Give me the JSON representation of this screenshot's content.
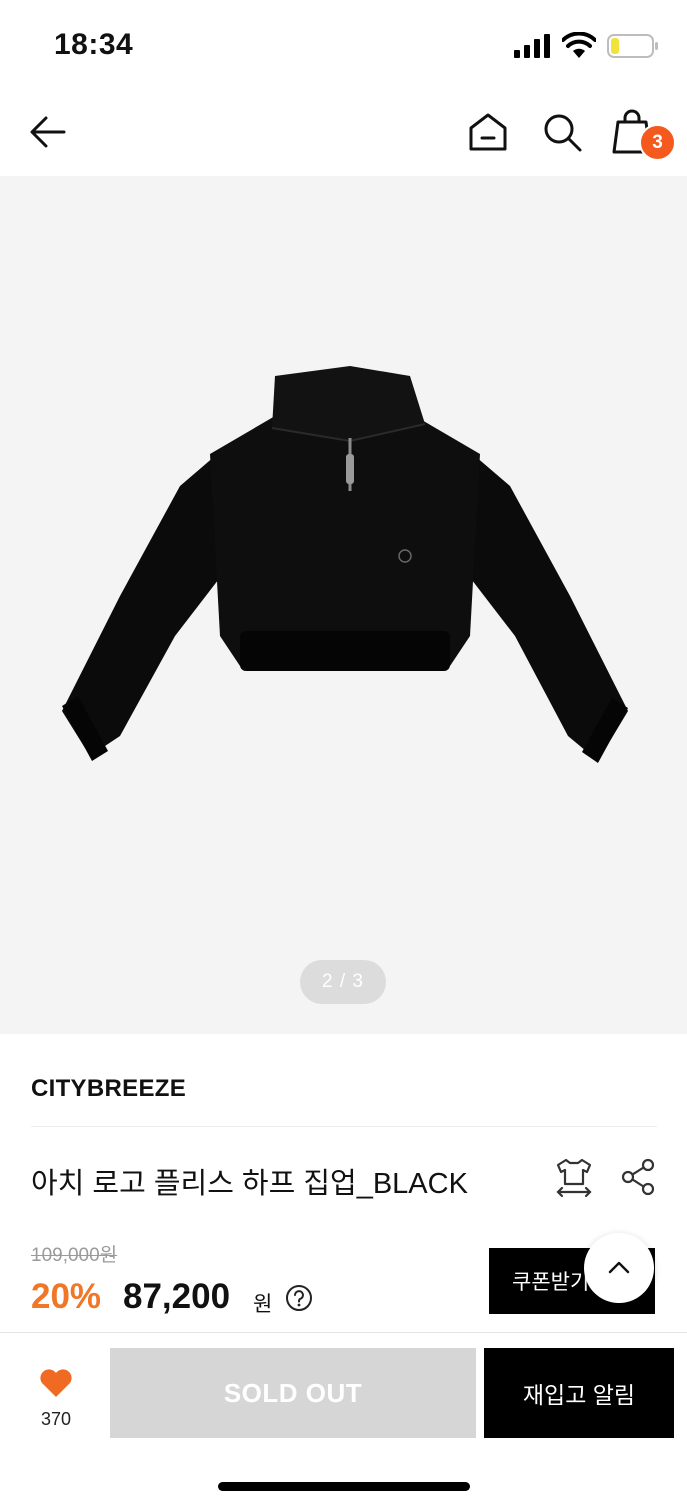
{
  "status_bar": {
    "time": "18:34"
  },
  "nav": {
    "cart_count": "3"
  },
  "gallery": {
    "pager": "2 / 3"
  },
  "product": {
    "brand": "CITYBREEZE",
    "title": "아치 로고 플리스 하프 집업_BLACK",
    "original_price": "109,000원",
    "discount": "20%",
    "price": "87,200",
    "currency": "원"
  },
  "actions": {
    "coupon_label": "쿠폰받기",
    "like_count": "370",
    "soldout_label": "SOLD OUT",
    "restock_label": "재입고 알림"
  },
  "colors": {
    "accent": "#f07628",
    "badge": "#f45a1d",
    "disabled": "#d6d6d6"
  }
}
